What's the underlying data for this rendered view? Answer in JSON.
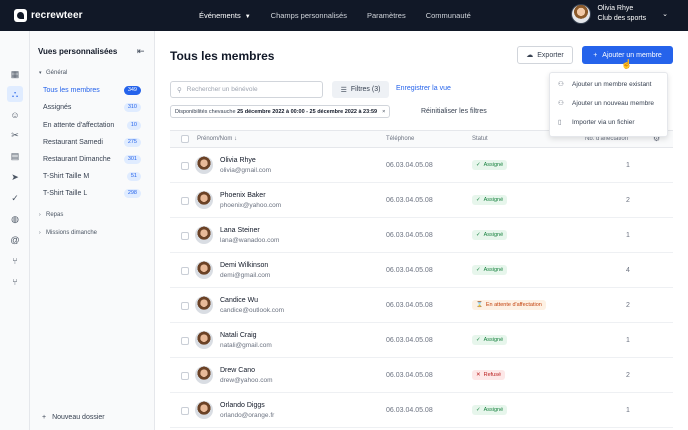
{
  "app": {
    "logo_text": "recrewteer"
  },
  "topnav": [
    {
      "label": "Événements",
      "active": true,
      "has_chevron": true
    },
    {
      "label": "Champs personnalisés",
      "active": false
    },
    {
      "label": "Paramètres",
      "active": false
    },
    {
      "label": "Communauté",
      "active": false
    }
  ],
  "user": {
    "name": "Olivia Rhye",
    "org": "Club des sports"
  },
  "rail_icons": [
    "grid-icon",
    "org-chart-icon",
    "users-icon",
    "tools-icon",
    "document-icon",
    "send-icon",
    "check-circle-icon",
    "globe-icon",
    "at-sign-icon",
    "branch-icon",
    "branch-alt-icon"
  ],
  "views": {
    "title": "Vues personnalisées",
    "group_general": "Général",
    "items": [
      {
        "label": "Tous les membres",
        "count": "349",
        "active": true
      },
      {
        "label": "Assignés",
        "count": "310"
      },
      {
        "label": "En attente d'affectation",
        "count": "10"
      },
      {
        "label": "Restaurant Samedi",
        "count": "275"
      },
      {
        "label": "Restaurant Dimanche",
        "count": "301"
      },
      {
        "label": "T-Shirt Taille M",
        "count": "51"
      },
      {
        "label": "T-Shirt Taille L",
        "count": "298"
      }
    ],
    "group_repas": "Repas",
    "group_missions": "Missions dimanche",
    "new_folder": "Nouveau dossier"
  },
  "main": {
    "title": "Tous les membres",
    "export_label": "Exporter",
    "add_label": "Ajouter un membre",
    "search_placeholder": "Rechercher un bénévole",
    "filters_label": "Filtres (3)",
    "save_view": "Enregistrer la vue",
    "chip_prefix": "Disponibilités chevauche",
    "chip_value": "25 décembre 2022 à 00:00 - 25 décembre 2022 à 23:59",
    "reset_label": "Réinitialiser les filtres"
  },
  "dropdown": [
    {
      "label": "Ajouter un membre existant",
      "icon": "user-icon"
    },
    {
      "label": "Ajouter un nouveau membre",
      "icon": "user-plus-icon"
    },
    {
      "label": "Importer via un fichier",
      "icon": "file-icon"
    }
  ],
  "table": {
    "headers": {
      "name": "Prénom/Nom",
      "phone": "Téléphone",
      "status": "Statut",
      "count": "Nb. d'affectation"
    },
    "rows": [
      {
        "name": "Olivia Rhye",
        "email": "olivia@gmail.com",
        "phone": "06.03.04.05.08",
        "status": "Assigné",
        "status_type": "ok",
        "count": "1"
      },
      {
        "name": "Phoenix Baker",
        "email": "phoenix@yahoo.com",
        "phone": "06.03.04.05.08",
        "status": "Assigné",
        "status_type": "ok",
        "count": "2"
      },
      {
        "name": "Lana Steiner",
        "email": "lana@wanadoo.com",
        "phone": "06.03.04.05.08",
        "status": "Assigné",
        "status_type": "ok",
        "count": "1"
      },
      {
        "name": "Demi Wilkinson",
        "email": "demi@gmail.com",
        "phone": "06.03.04.05.08",
        "status": "Assigné",
        "status_type": "ok",
        "count": "4"
      },
      {
        "name": "Candice Wu",
        "email": "candice@outlook.com",
        "phone": "06.03.04.05.08",
        "status": "En attente d'affectation",
        "status_type": "wait",
        "count": "2"
      },
      {
        "name": "Natali Craig",
        "email": "natali@gmail.com",
        "phone": "06.03.04.05.08",
        "status": "Assigné",
        "status_type": "ok",
        "count": "1"
      },
      {
        "name": "Drew Cano",
        "email": "drew@yahoo.com",
        "phone": "06.03.04.05.08",
        "status": "Refusé",
        "status_type": "no",
        "count": "2"
      },
      {
        "name": "Orlando Diggs",
        "email": "orlando@orange.fr",
        "phone": "06.03.04.05.08",
        "status": "Assigné",
        "status_type": "ok",
        "count": "1"
      }
    ]
  },
  "colors": {
    "primary": "#2563eb",
    "topbar": "#111827",
    "success": "#15803d",
    "warning": "#c2410c",
    "danger": "#b91c1c"
  }
}
